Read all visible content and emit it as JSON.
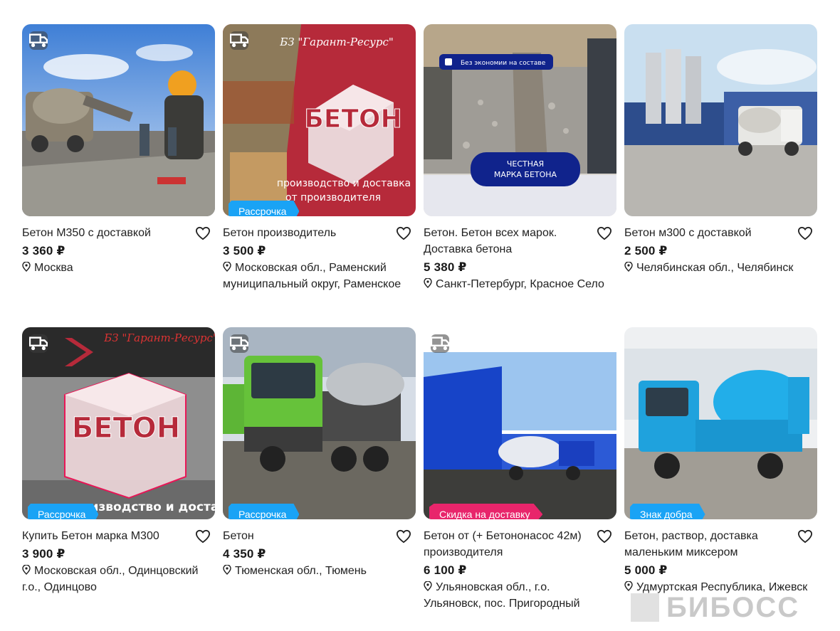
{
  "listings": [
    {
      "title": "Бетон М350 с доставкой",
      "price": "3 360 ₽",
      "location": "Москва",
      "badge": "",
      "delivery": true,
      "thumb": "concrete pouring with mixer truck"
    },
    {
      "title": "Бетон производитель",
      "price": "3 500 ₽",
      "location": "Московская обл., Раменский муниципальный округ, Раменское",
      "badge": "Рассрочка",
      "delivery": true,
      "thumb_text": [
        "БЗ \"Гарант-Ресурс\"",
        "БЕТОН",
        "производство и доставка",
        "от производителя"
      ]
    },
    {
      "title": "Бетон. Бетон всех марок. Доставка бетона",
      "price": "5 380 ₽",
      "location": "Санкт-Петербург, Красное Село",
      "badge": "",
      "delivery": false,
      "thumb_text": [
        "Без экономии на составе",
        "ЧЕСТНАЯ",
        "МАРКА БЕТОНА"
      ]
    },
    {
      "title": "Бетон м300 с доставкой",
      "price": "2 500 ₽",
      "location": "Челябинская обл., Челябинск",
      "badge": "",
      "delivery": false,
      "thumb": "concrete plant with mixer truck"
    },
    {
      "title": "Купить Бетон марка М300",
      "price": "3 900 ₽",
      "location": "Московская обл., Одинцовский г.о., Одинцово",
      "badge": "Рассрочка",
      "delivery": true,
      "thumb_text": [
        "БЗ \"Гарант-Ресурс\"",
        "БЕТОН",
        "производство и доставка"
      ]
    },
    {
      "title": "Бетон",
      "price": "4 350 ₽",
      "location": "Тюменская обл., Тюмень",
      "badge": "Рассрочка",
      "delivery": true,
      "thumb": "green concrete mixer trucks"
    },
    {
      "title": "Бетон от (+ Бетононасос 42м) производителя",
      "price": "6 100 ₽",
      "location": "Ульяновская обл., г.о. Ульяновск, пос. Пригородный",
      "badge": "Скидка на доставку",
      "delivery": true,
      "thumb": "blue plant with mixer trucks"
    },
    {
      "title": "Бетон, раствор, доставка маленьким миксером",
      "price": "5 000 ₽",
      "location": "Удмуртская Республика, Ижевск",
      "badge": "Знак добра",
      "delivery": false,
      "thumb": "blue small concrete mixer truck"
    }
  ],
  "watermark": "БИБОСС",
  "colors": {
    "badge_blue": "#1aa3f5",
    "badge_pink": "#e8256b"
  },
  "icons": {
    "favorite": "heart-icon",
    "location": "map-pin-icon",
    "delivery": "truck-icon"
  }
}
